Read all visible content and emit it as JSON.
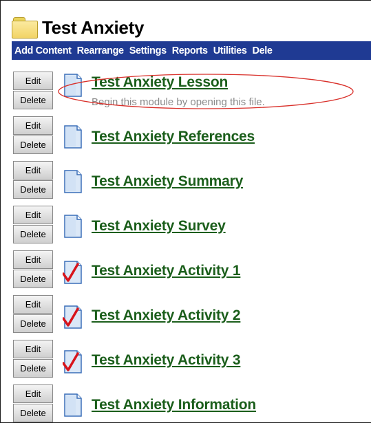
{
  "page": {
    "title": "Test Anxiety"
  },
  "menu": {
    "items": [
      "Add Content",
      "Rearrange",
      "Settings",
      "Reports",
      "Utilities",
      "Dele"
    ]
  },
  "content_items": [
    {
      "title": "Test Anxiety Lesson",
      "description": "Begin this module by opening this file.",
      "icon": "document-icon",
      "edit_label": "Edit",
      "delete_label": "Delete"
    },
    {
      "title": "Test Anxiety References",
      "icon": "document-icon",
      "edit_label": "Edit",
      "delete_label": "Delete"
    },
    {
      "title": "Test Anxiety Summary",
      "icon": "document-icon",
      "edit_label": "Edit",
      "delete_label": "Delete"
    },
    {
      "title": "Test Anxiety Survey",
      "icon": "document-icon",
      "edit_label": "Edit",
      "delete_label": "Delete"
    },
    {
      "title": "Test Anxiety Activity 1",
      "icon": "assignment-check-icon",
      "edit_label": "Edit",
      "delete_label": "Delete"
    },
    {
      "title": "Test Anxiety Activity 2",
      "icon": "assignment-check-icon",
      "edit_label": "Edit",
      "delete_label": "Delete"
    },
    {
      "title": "Test Anxiety Activity 3",
      "icon": "assignment-check-icon",
      "edit_label": "Edit",
      "delete_label": "Delete"
    },
    {
      "title": "Test Anxiety Information",
      "icon": "document-icon",
      "edit_label": "Edit",
      "delete_label": "Delete"
    }
  ],
  "colors": {
    "menu_bar": "#1f3a93",
    "link": "#1b5e1b",
    "highlight": "#d9302a"
  }
}
